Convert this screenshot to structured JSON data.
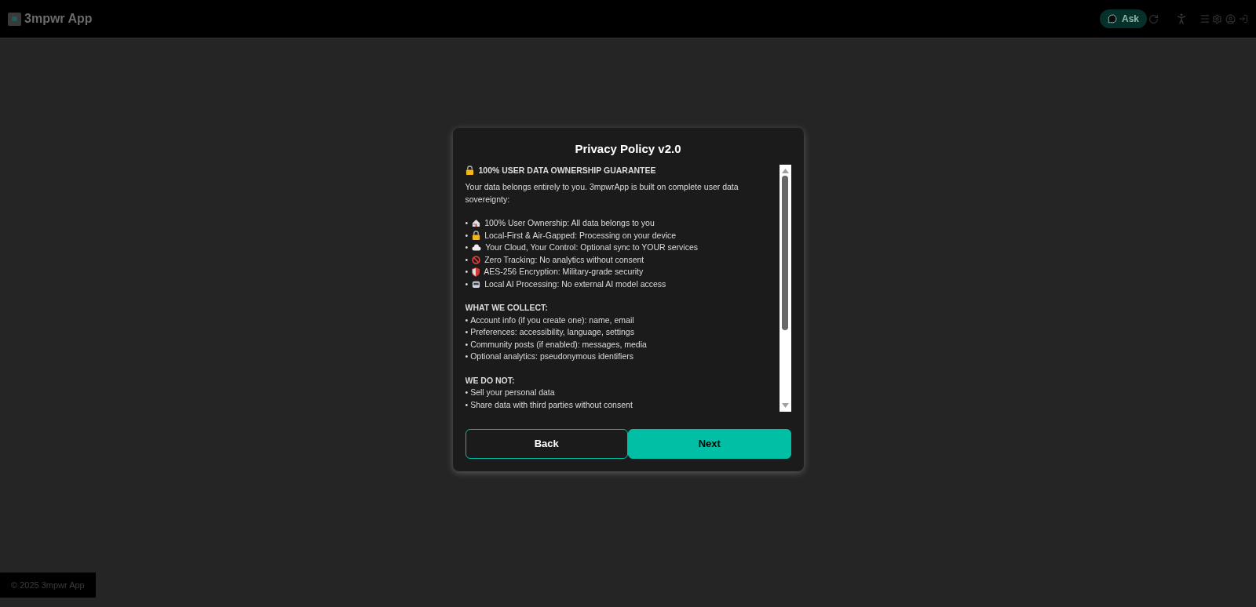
{
  "header": {
    "app_name": "3mpwr App",
    "ask_button": "Ask"
  },
  "dialog": {
    "title": "Privacy Policy v2.0",
    "heading": "100% USER DATA OWNERSHIP GUARANTEE",
    "bullet": "•",
    "intro": "Your data belongs entirely to you. 3mpwrApp is built on complete user data sovereignty:",
    "features": [
      "100% User Ownership: All data belongs to you",
      "Local-First & Air-Gapped: Processing on your device",
      "Your Cloud, Your Control: Optional sync to YOUR services",
      "Zero Tracking: No analytics without consent",
      "AES-256 Encryption: Military-grade security",
      "Local AI Processing: No external AI model access"
    ],
    "sections": [
      {
        "title": "WHAT WE COLLECT:",
        "items": [
          "Account info (if you create one): name, email",
          "Preferences: accessibility, language, settings",
          "Community posts (if enabled): messages, media",
          "Optional analytics: pseudonymous identifiers"
        ]
      },
      {
        "title": "WE DO NOT:",
        "items": [
          "Sell your personal data",
          "Share data with third parties without consent"
        ]
      }
    ],
    "buttons": [
      {
        "label": "Back",
        "kind": "secondary"
      },
      {
        "label": "Next",
        "kind": "primary"
      }
    ]
  },
  "footer": "© 2025 3mpwr App"
}
